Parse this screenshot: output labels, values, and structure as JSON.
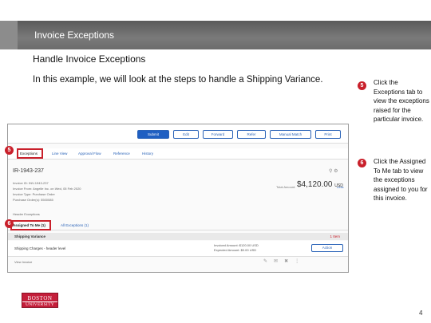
{
  "header": {
    "title": "Invoice Exceptions"
  },
  "subtitle": "Handle Invoice Exceptions",
  "intro": "In this example, we will look at the steps to handle a Shipping Variance.",
  "screenshot": {
    "toolbar": [
      "Submit",
      "Edit",
      "Forward",
      "Refer",
      "Manual Match",
      "Print"
    ],
    "tabs": [
      "Exceptions",
      "Line View",
      "Approval Flow",
      "Reference",
      "History"
    ],
    "invoice_id": "IR-1943-237",
    "meta": [
      "Invoice ID: INV-1943-237",
      "Invoice From: Angelle Inc. on Wed, 05 Feb 2020",
      "Invoice Type: Purchase Order",
      "Purchase Order(s): 5500085"
    ],
    "total_label": "Total Amount:",
    "total_amount": "$4,120.00",
    "total_currency": "USD",
    "less_link": "Less",
    "section_label": "Header Exceptions",
    "subtabs": [
      "Assigned To Me (1)",
      "All Exceptions (1)"
    ],
    "exception_title": "Shipping Variance",
    "exception_count": "1 Item",
    "exception_desc": "Shipping Charges - header level",
    "invoice_amount": "Invoiced Amount: $120.00 USD",
    "expected_amount": "Expected Amount: $0.00 USD",
    "action_label": "Action",
    "footer_text": "View Invoice"
  },
  "markers": {
    "m1": "5",
    "m2": "6"
  },
  "steps": [
    {
      "number": "5",
      "text": "Click the Exceptions tab to view the exceptions raised for the particular invoice."
    },
    {
      "number": "6",
      "text": "Click the Assigned To Me tab to view the exceptions assigned to you for this invoice."
    }
  ],
  "logo": {
    "line1": "BOSTON",
    "line2": "UNIVERSITY"
  },
  "page_number": "4",
  "colors": {
    "accent": "#c9202b",
    "titlebar": "#6c6c6c",
    "link": "#2a63b8"
  }
}
